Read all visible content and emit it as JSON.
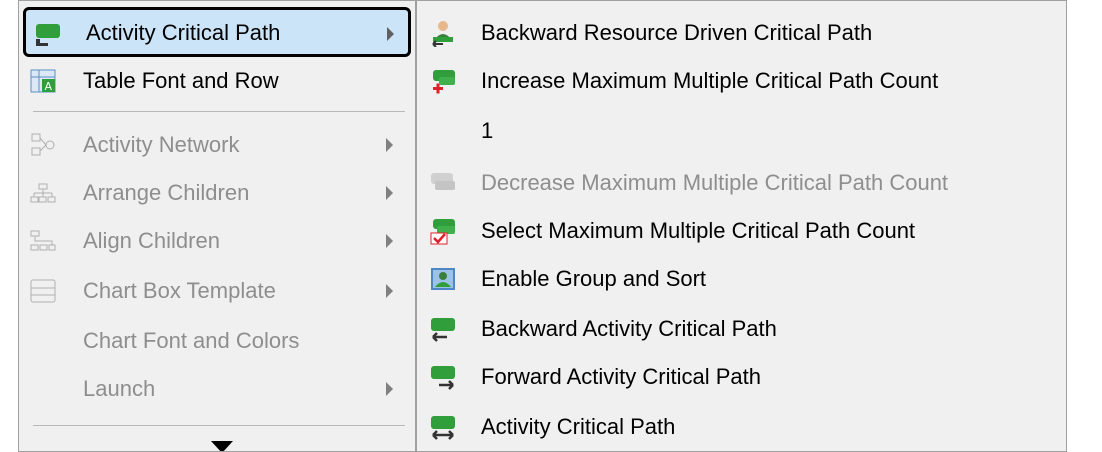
{
  "left_menu": {
    "items": [
      {
        "label": "Activity Critical Path",
        "icon": "critical-path-icon",
        "state": "selected",
        "submenu": true
      },
      {
        "label": "Table Font and Row",
        "icon": "table-font-icon",
        "state": "enabled",
        "submenu": false
      },
      {
        "label": "Activity Network",
        "icon": "activity-network-icon",
        "state": "disabled",
        "submenu": true
      },
      {
        "label": "Arrange Children",
        "icon": "arrange-children-icon",
        "state": "disabled",
        "submenu": true
      },
      {
        "label": "Align Children",
        "icon": "align-children-icon",
        "state": "disabled",
        "submenu": true
      },
      {
        "label": "Chart Box Template",
        "icon": "chart-box-template-icon",
        "state": "disabled",
        "submenu": true
      },
      {
        "label": "Chart Font and Colors",
        "icon": "",
        "state": "disabled",
        "submenu": false
      },
      {
        "label": "Launch",
        "icon": "",
        "state": "disabled",
        "submenu": true
      }
    ],
    "more_indicator": "scroll-down-arrow-icon"
  },
  "right_menu": {
    "items": [
      {
        "label": "Backward Resource Driven Critical Path",
        "icon": "backward-resource-icon",
        "state": "enabled"
      },
      {
        "label": "Increase Maximum Multiple Critical Path Count",
        "icon": "increase-count-icon",
        "state": "enabled"
      },
      {
        "label": "1",
        "icon": "",
        "state": "value"
      },
      {
        "label": "Decrease Maximum Multiple Critical Path Count",
        "icon": "decrease-count-icon",
        "state": "disabled"
      },
      {
        "label": "Select Maximum Multiple Critical Path Count",
        "icon": "select-count-icon",
        "state": "enabled"
      },
      {
        "label": "Enable Group and Sort",
        "icon": "group-sort-icon",
        "state": "enabled"
      },
      {
        "label": "Backward Activity Critical Path",
        "icon": "backward-activity-icon",
        "state": "enabled"
      },
      {
        "label": "Forward Activity Critical Path",
        "icon": "forward-activity-icon",
        "state": "enabled"
      },
      {
        "label": "Activity Critical Path",
        "icon": "activity-critical-path-icon",
        "state": "enabled"
      }
    ]
  },
  "colors": {
    "menu_bg": "#f0f0f0",
    "selected_bg": "#cce4f7",
    "disabled_text": "#8e8e8e",
    "icon_green": "#2f9e3b",
    "icon_red": "#e0202a"
  }
}
